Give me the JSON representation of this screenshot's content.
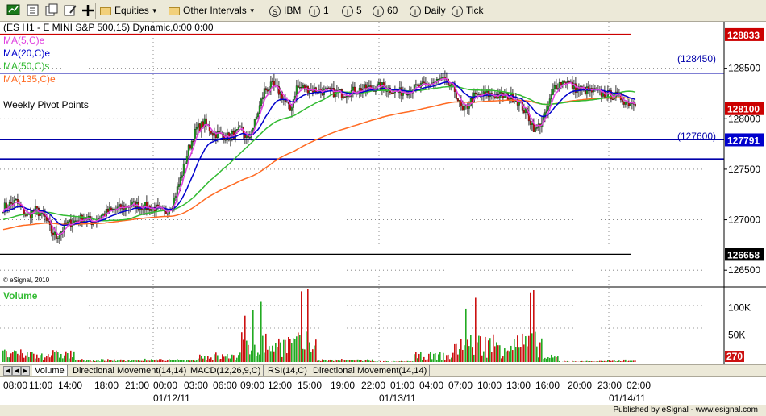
{
  "toolbar": {
    "equities": "Equities",
    "intervals": "Other Intervals",
    "symbol": "IBM",
    "int1": "1",
    "int5": "5",
    "int60": "60",
    "daily": "Daily",
    "tick": "Tick"
  },
  "chart": {
    "title": "(ES H1 - E MINI S&P 500,15) Dynamic,0:00 0:00",
    "ma_labels": [
      {
        "text": "MA(5,C)e",
        "color": "#e040e0"
      },
      {
        "text": "MA(20,C)e",
        "color": "#0000cc"
      },
      {
        "text": "MA(50,C)s",
        "color": "#33bb33"
      },
      {
        "text": "MA(135,C)e",
        "color": "#ff6a22"
      }
    ],
    "pivot_title": "Weekly Pivot Points",
    "copyright": "© eSignal, 2010",
    "hlines": [
      {
        "value": 1288.33,
        "color": "#cc0000",
        "label": null,
        "tag": "128833",
        "tag_color": "#cc0000"
      },
      {
        "value": 1284.5,
        "color": "#0000aa",
        "label": "(128450)"
      },
      {
        "value": 1277.91,
        "color": "#0000aa",
        "label": null,
        "tag": "127791",
        "tag_color": "#0000cc"
      },
      {
        "value": 1276.0,
        "color": "#0000aa",
        "label": "(127600)"
      },
      {
        "value": 1266.58,
        "color": "#000000",
        "label": null,
        "tag": "126658",
        "tag_color": "#000000"
      }
    ],
    "last_price_tag": "128100",
    "last_price_color": "#cc0000",
    "price_axis": {
      "min": 1263.5,
      "max": 1289.6,
      "ticks": [
        "128500",
        "128000",
        "127500",
        "127000",
        "126500"
      ],
      "tick_values": [
        1285,
        1280,
        1275,
        1270,
        1265
      ]
    },
    "volume": {
      "label": "Volume",
      "ticks": [
        "100K",
        "50K"
      ],
      "tick_values": [
        100000,
        50000
      ],
      "max": 135000,
      "last_tag": "270"
    },
    "time_labels": [
      "08:00",
      "11:00",
      "14:00",
      "18:00",
      "21:00",
      "00:00",
      "03:00",
      "06:00",
      "09:00",
      "12:00",
      "15:00",
      "19:00",
      "22:00",
      "01:00",
      "04:00",
      "07:00",
      "10:00",
      "13:00",
      "16:00",
      "20:00",
      "23:00",
      "02:00"
    ],
    "date_labels": [
      "01/12/11",
      "01/13/11",
      "01/14/11"
    ]
  },
  "chart_data": {
    "type": "candlestick",
    "instrument": "ES H1 - E MINI S&P 500",
    "interval": "15 min",
    "price_anchors": [
      [
        0,
        1271.2
      ],
      [
        8,
        1271.8
      ],
      [
        15,
        1270.3
      ],
      [
        20,
        1271.0
      ],
      [
        26,
        1270.2
      ],
      [
        30,
        1268.8
      ],
      [
        33,
        1268.3
      ],
      [
        40,
        1269.6
      ],
      [
        50,
        1270.2
      ],
      [
        55,
        1269.8
      ],
      [
        65,
        1270.8
      ],
      [
        80,
        1271.5
      ],
      [
        95,
        1271.1
      ],
      [
        100,
        1270.6
      ],
      [
        105,
        1271.6
      ],
      [
        110,
        1274.0
      ],
      [
        115,
        1277.0
      ],
      [
        120,
        1279.0
      ],
      [
        125,
        1279.6
      ],
      [
        130,
        1278.6
      ],
      [
        140,
        1278.2
      ],
      [
        148,
        1278.9
      ],
      [
        152,
        1277.8
      ],
      [
        156,
        1279.6
      ],
      [
        162,
        1282.8
      ],
      [
        167,
        1283.3
      ],
      [
        172,
        1282.5
      ],
      [
        178,
        1280.8
      ],
      [
        182,
        1283.1
      ],
      [
        188,
        1283.0
      ],
      [
        200,
        1282.7
      ],
      [
        210,
        1282.5
      ],
      [
        222,
        1282.9
      ],
      [
        235,
        1283.2
      ],
      [
        245,
        1282.6
      ],
      [
        262,
        1283.3
      ],
      [
        272,
        1283.9
      ],
      [
        280,
        1282.8
      ],
      [
        285,
        1280.6
      ],
      [
        292,
        1282.2
      ],
      [
        300,
        1282.4
      ],
      [
        308,
        1282.3
      ],
      [
        318,
        1282.0
      ],
      [
        325,
        1280.4
      ],
      [
        330,
        1278.8
      ],
      [
        336,
        1280.2
      ],
      [
        342,
        1283.2
      ],
      [
        348,
        1283.8
      ],
      [
        355,
        1283.0
      ],
      [
        365,
        1282.7
      ],
      [
        375,
        1282.4
      ],
      [
        382,
        1282.2
      ],
      [
        387,
        1281.6
      ],
      [
        392,
        1281.7
      ]
    ],
    "weekly_pivot_points": [
      1288.33,
      1284.5,
      1277.91,
      1276.0,
      1266.58
    ],
    "last_price": 1281.0,
    "volume_spikes": [
      {
        "bar": 150,
        "volume": 85000
      },
      {
        "bar": 155,
        "volume": 95000
      },
      {
        "bar": 160,
        "volume": 112000
      },
      {
        "bar": 185,
        "volume": 130000
      },
      {
        "bar": 189,
        "volume": 135000
      },
      {
        "bar": 287,
        "volume": 98000
      },
      {
        "bar": 293,
        "volume": 118000
      },
      {
        "bar": 327,
        "volume": 128000
      },
      {
        "bar": 329,
        "volume": 132000
      }
    ]
  }
}
